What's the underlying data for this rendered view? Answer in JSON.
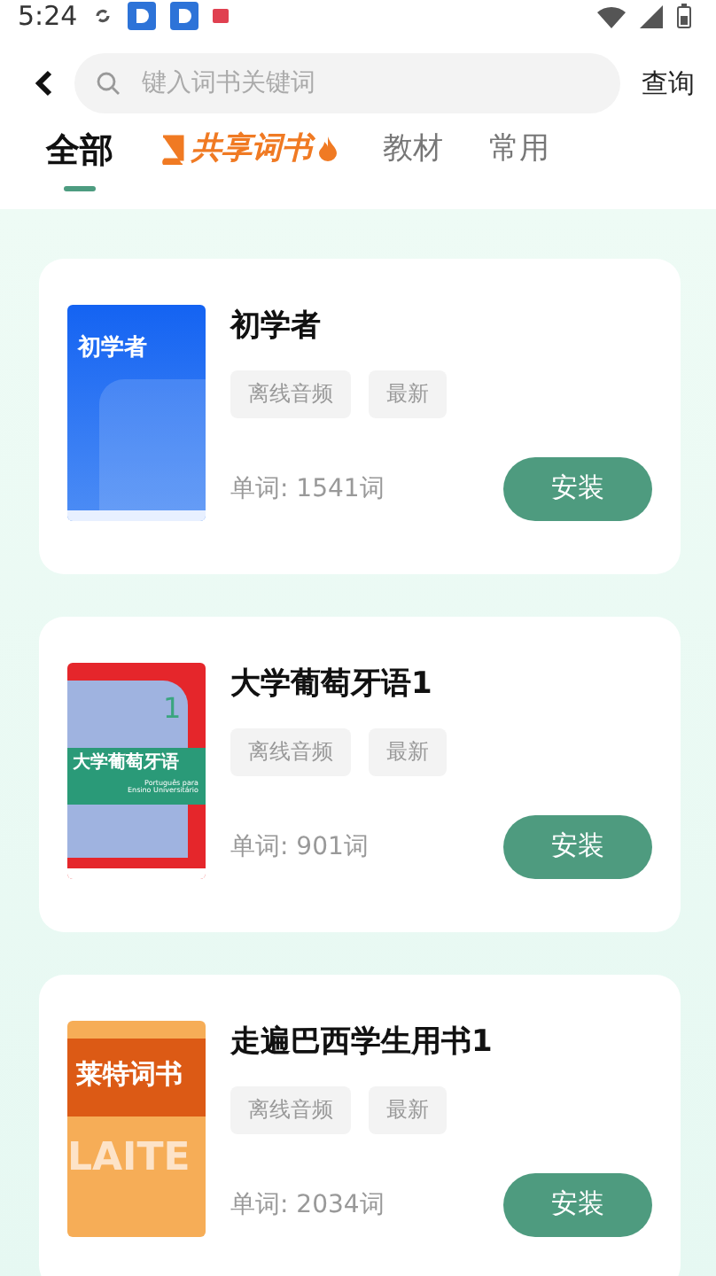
{
  "status_bar": {
    "time": "5:24"
  },
  "search": {
    "placeholder": "键入词书关键词",
    "button": "查询"
  },
  "tabs": [
    {
      "label": "全部",
      "kind": "plain",
      "selected": true
    },
    {
      "label": "共享词书",
      "kind": "promo",
      "selected": false
    },
    {
      "label": "教材",
      "kind": "plain",
      "selected": false
    },
    {
      "label": "常用",
      "kind": "plain",
      "selected": false
    }
  ],
  "books": [
    {
      "title": "初学者",
      "cover": {
        "kind": "blue",
        "lines": [
          "初学者"
        ]
      },
      "tags": [
        "离线音频",
        "最新"
      ],
      "words": "单词: 1541词",
      "action": "安装"
    },
    {
      "title": "大学葡萄牙语1",
      "cover": {
        "kind": "red",
        "lines": [
          "1",
          "大学葡萄牙语",
          "Português para",
          "Ensino Universitário"
        ]
      },
      "tags": [
        "离线音频",
        "最新"
      ],
      "words": "单词: 901词",
      "action": "安装"
    },
    {
      "title": "走遍巴西学生用书1",
      "cover": {
        "kind": "orange",
        "lines": [
          "莱特词书",
          "LAITE"
        ]
      },
      "tags": [
        "离线音频",
        "最新"
      ],
      "words": "单词: 2034词",
      "action": "安装"
    }
  ]
}
